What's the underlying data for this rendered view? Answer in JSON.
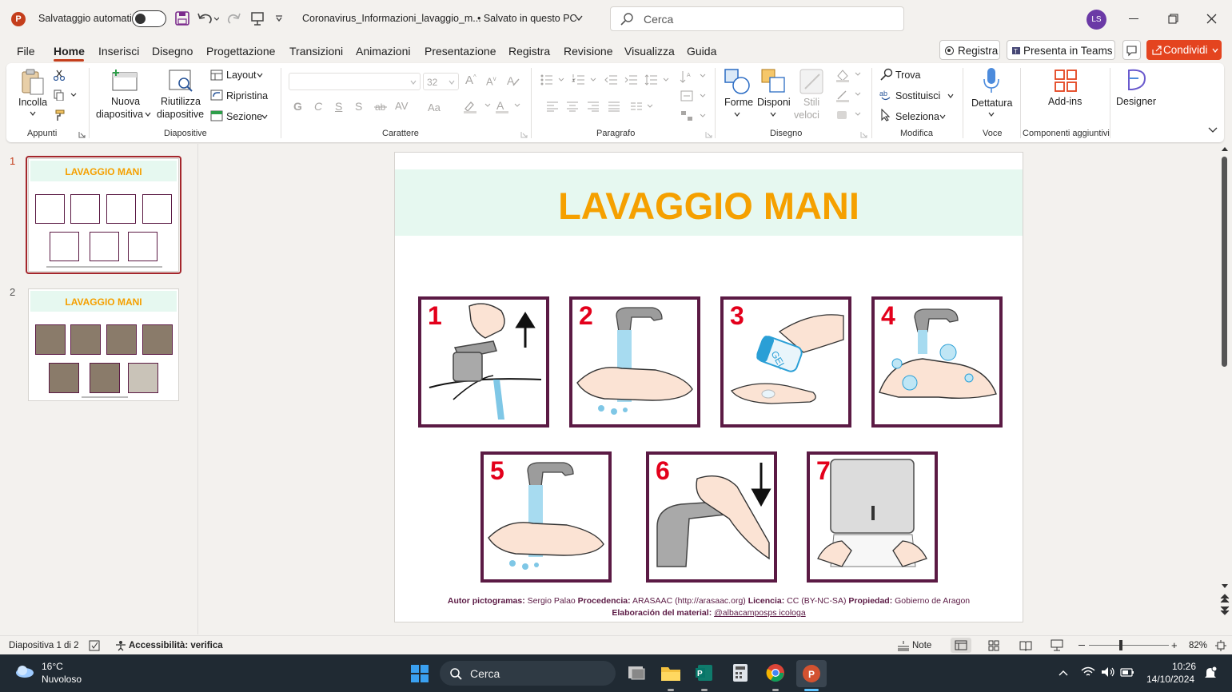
{
  "titlebar": {
    "autosave_label": "Salvataggio automatico",
    "filename": "Coronavirus_Informazioni_lavaggio_m...",
    "save_status": "• Salvato in questo PC",
    "search_placeholder": "Cerca",
    "user_initials": "LS"
  },
  "menu": {
    "items": [
      "File",
      "Home",
      "Inserisci",
      "Disegno",
      "Progettazione",
      "Transizioni",
      "Animazioni",
      "Presentazione",
      "Registra",
      "Revisione",
      "Visualizza",
      "Guida"
    ],
    "active": "Home",
    "record_button": "Registra",
    "teams_button": "Presenta in Teams",
    "share_button": "Condividi"
  },
  "ribbon": {
    "paste": "Incolla",
    "new_slide_1": "Nuova",
    "new_slide_2": "diapositiva",
    "reuse_1": "Riutilizza",
    "reuse_2": "diapositive",
    "layout": "Layout",
    "reset": "Ripristina",
    "section": "Sezione",
    "font_size": "32",
    "shapes": "Forme",
    "arrange": "Disponi",
    "quick_styles_1": "Stili",
    "quick_styles_2": "veloci",
    "find": "Trova",
    "replace": "Sostituisci",
    "select": "Seleziona",
    "dictate": "Dettatura",
    "addins": "Add-ins",
    "designer": "Designer",
    "fmt_bold": "G",
    "fmt_italic": "C",
    "fmt_underline": "S",
    "fmt_shadow": "S",
    "fmt_spacing": "AV",
    "fmt_case": "Aa",
    "groups": {
      "clipboard": "Appunti",
      "slides": "Diapositive",
      "font": "Carattere",
      "paragraph": "Paragrafo",
      "drawing": "Disegno",
      "editing": "Modifica",
      "voice": "Voce",
      "addins": "Componenti aggiuntivi"
    }
  },
  "thumbnails": [
    {
      "number": "1",
      "title": "LAVAGGIO MANI",
      "selected": true
    },
    {
      "number": "2",
      "title": "LAVAGGIO MANI",
      "selected": false
    }
  ],
  "slide": {
    "title": "LAVAGGIO MANI",
    "title_color": "#f5a000",
    "steps": [
      "1",
      "2",
      "3",
      "4",
      "5",
      "6",
      "7"
    ],
    "gel_label": "GEL",
    "credit_line1": {
      "k1": "Autor pictogramas:",
      "v1": "Sergio Palao",
      "k2": "Procedencia:",
      "v2": "ARASAAC (http://arasaac.org)",
      "k3": "Licencia:",
      "v3": "CC (BY-NC-SA)",
      "k4": "Propiedad:",
      "v4": "Gobierno de Aragon"
    },
    "credit_line2": {
      "k": "Elaboración del material:",
      "v": "@albacamposps icologa"
    }
  },
  "statusbar": {
    "slide_counter": "Diapositiva 1 di 2",
    "accessibility": "Accessibilità: verifica",
    "notes": "Note",
    "zoom": "82%"
  },
  "taskbar": {
    "weather_temp": "16°C",
    "weather_desc": "Nuvoloso",
    "search": "Cerca",
    "time": "10:26",
    "date": "14/10/2024"
  },
  "colors": {
    "accent": "#c43e1c",
    "share": "#e4441f",
    "frame": "#5b1a44",
    "number": "#e3001b"
  }
}
